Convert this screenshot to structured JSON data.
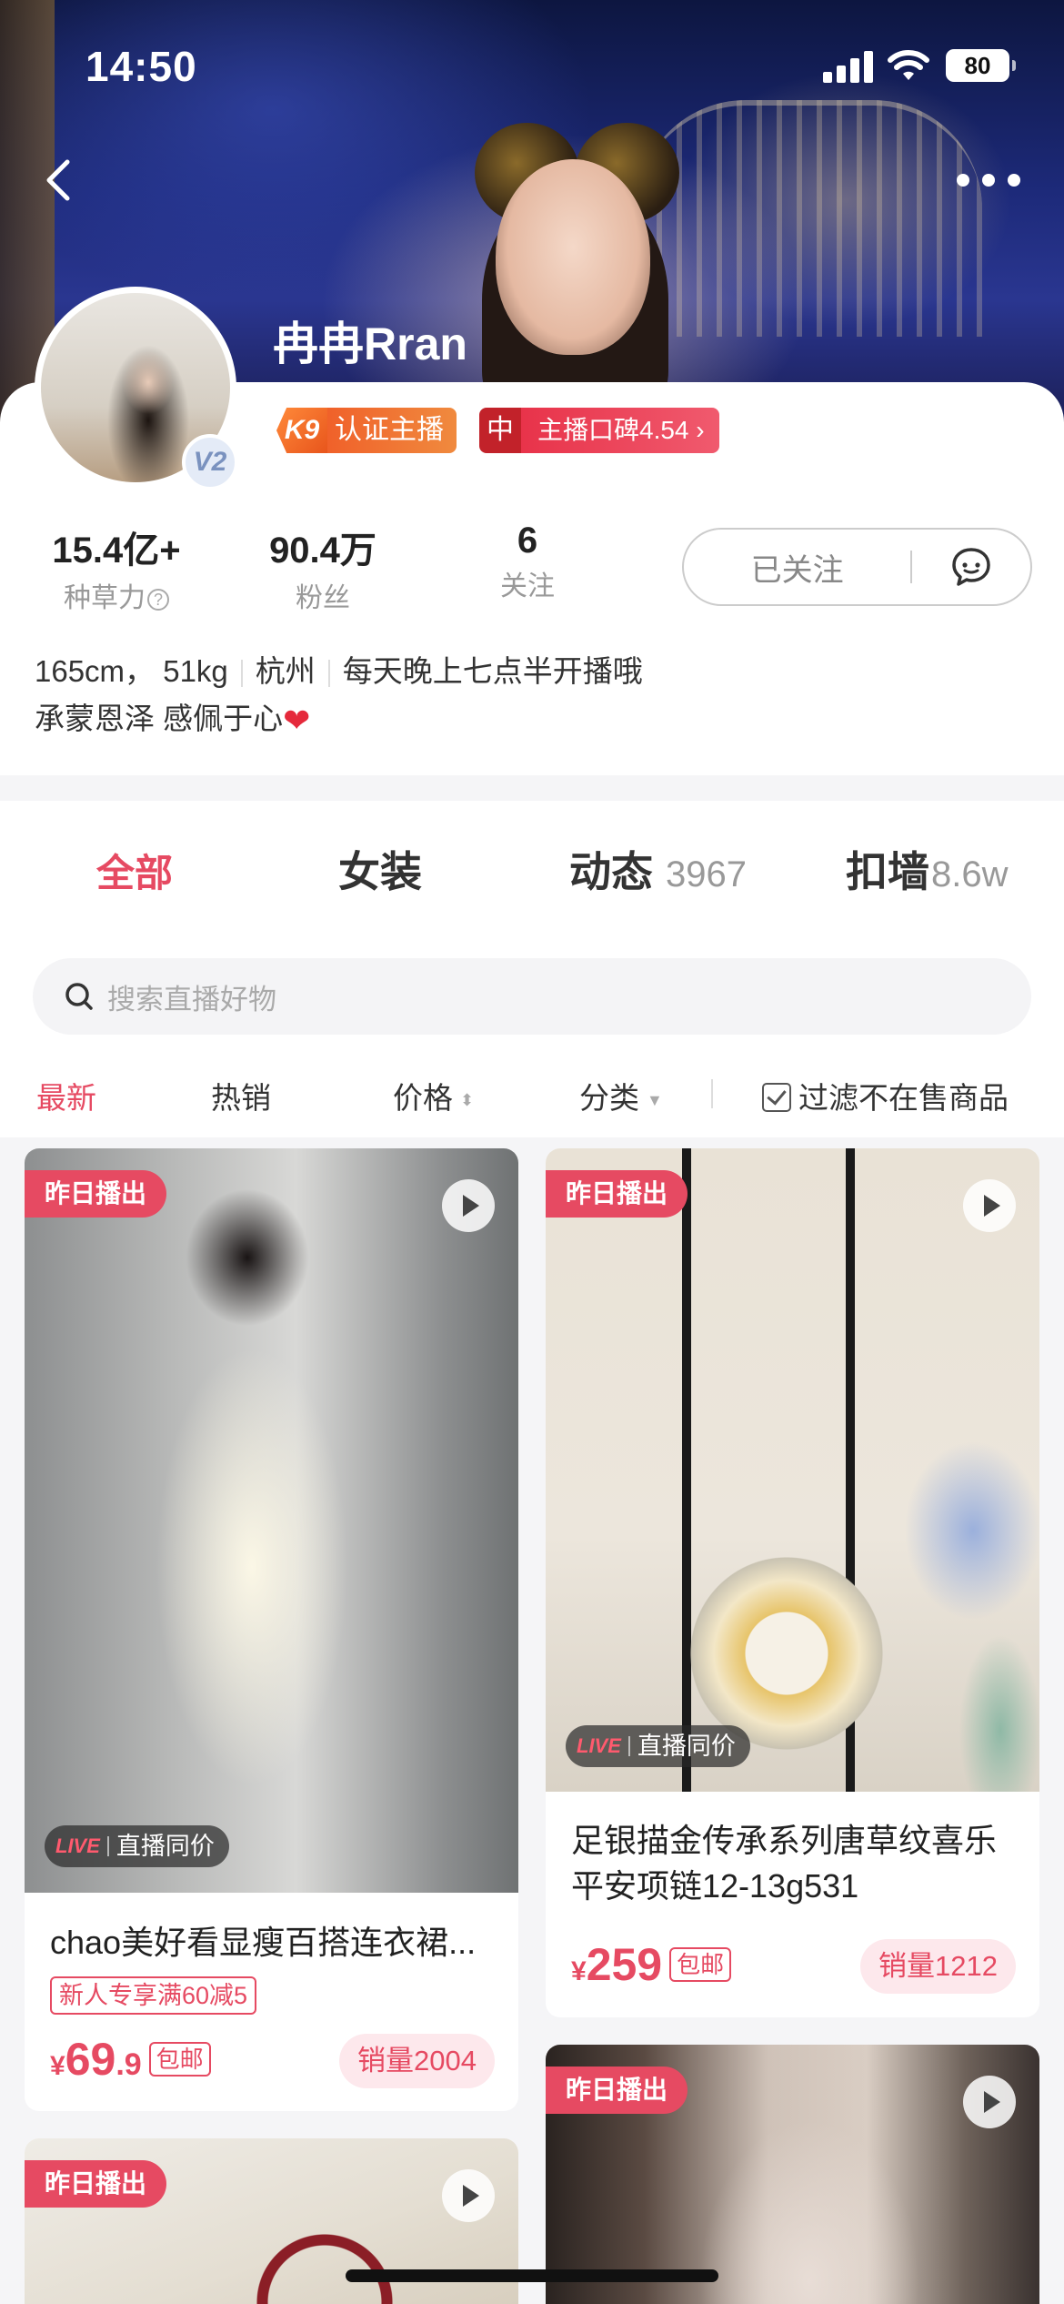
{
  "status_bar": {
    "time": "14:50",
    "battery": "80"
  },
  "profile": {
    "nickname": "冉冉Rran",
    "badge_level": "K9",
    "badge_text": "认证主播",
    "reputation_level": "中",
    "reputation_text": "主播口碑4.54",
    "avatar_badge": "V2",
    "stats": [
      {
        "value": "15.4亿+",
        "label": "种草力"
      },
      {
        "value": "90.4万",
        "label": "粉丝"
      },
      {
        "value": "6",
        "label": "关注"
      }
    ],
    "follow_label": "已关注",
    "bio_height_weight": "165cm， 51kg",
    "bio_city": "杭州",
    "bio_schedule": "每天晚上七点半开播哦",
    "bio_line2": "承蒙恩泽 感佩于心"
  },
  "tabs": [
    {
      "label": "全部",
      "count": ""
    },
    {
      "label": "女装",
      "count": ""
    },
    {
      "label": "动态",
      "count": "3967"
    },
    {
      "label": "扣墙",
      "count": "8.6w"
    }
  ],
  "search": {
    "placeholder": "搜索直播好物"
  },
  "filters": {
    "latest": "最新",
    "hot": "热销",
    "price": "价格",
    "category": "分类",
    "filter_out_of_stock": "过滤不在售商品"
  },
  "products": [
    {
      "tag": "昨日播出",
      "live_label": "LIVE",
      "live_text": "直播同价",
      "title": "chao美好看显瘦百搭连衣裙...",
      "coupon": "新人专享满60减5",
      "price_symbol": "¥",
      "price_int": "69",
      "price_dec": ".9",
      "shipping": "包邮",
      "sales": "销量2004"
    },
    {
      "tag": "昨日播出",
      "live_label": "LIVE",
      "live_text": "直播同价",
      "title": "足银描金传承系列唐草纹喜乐平安项链12-13g531",
      "price_symbol": "¥",
      "price_int": "259",
      "price_dec": "",
      "shipping": "包邮",
      "sales": "销量1212"
    },
    {
      "tag": "昨日播出"
    },
    {
      "tag": "昨日播出"
    }
  ],
  "colors": {
    "accent": "#e64a62",
    "badge_orange": "#f0612a"
  },
  "icons": [
    "back-icon",
    "more-icon",
    "chat-icon",
    "search-icon",
    "play-icon",
    "question-icon",
    "heart-icon",
    "checkbox-icon"
  ]
}
